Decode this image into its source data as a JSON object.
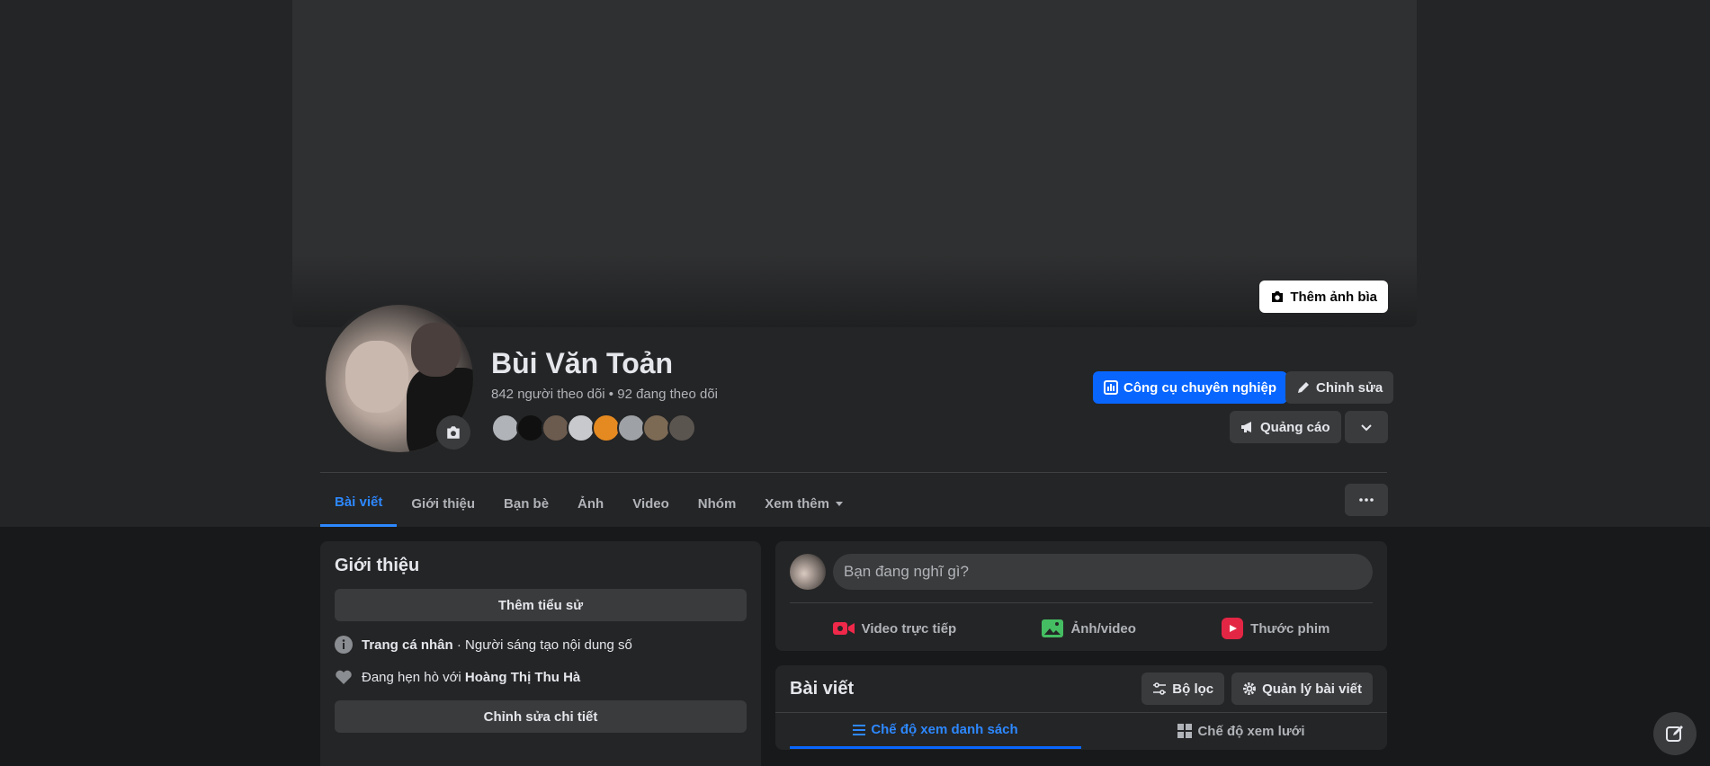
{
  "cover": {
    "add_cover_label": "Thêm ảnh bìa"
  },
  "profile": {
    "name": "Bùi Văn Toản",
    "stats": "842 người theo dõi • 92 đang theo dõi",
    "friend_avatar_colors": [
      "#b0b3b8",
      "#101010",
      "#6b5a4e",
      "#c7c9cc",
      "#e58a20",
      "#9ea1a5",
      "#7c6a55",
      "#5b5550"
    ]
  },
  "actions": {
    "pro_tools": "Công cụ chuyên nghiệp",
    "edit": "Chỉnh sửa",
    "ads": "Quảng cáo"
  },
  "tabs": [
    {
      "label": "Bài viết",
      "active": true
    },
    {
      "label": "Giới thiệu"
    },
    {
      "label": "Bạn bè"
    },
    {
      "label": "Ảnh"
    },
    {
      "label": "Video"
    },
    {
      "label": "Nhóm"
    },
    {
      "label": "Xem thêm"
    }
  ],
  "intro": {
    "title": "Giới thiệu",
    "add_bio": "Thêm tiểu sử",
    "page_label": "Trang cá nhân",
    "page_value": " · Người sáng tạo nội dung số",
    "dating_prefix": "Đang hẹn hò với ",
    "dating_name": "Hoàng Thị Thu Hà",
    "edit_details": "Chỉnh sửa chi tiết"
  },
  "composer": {
    "placeholder": "Bạn đang nghĩ gì?",
    "live_video": "Video trực tiếp",
    "photo_video": "Ảnh/video",
    "reel": "Thước phim"
  },
  "posts": {
    "title": "Bài viết",
    "filter": "Bộ lọc",
    "manage": "Quản lý bài viết",
    "list_view": "Chế độ xem danh sách",
    "grid_view": "Chế độ xem lưới"
  },
  "colors": {
    "accent": "#0866ff",
    "tab_active": "#2d88ff",
    "bg": "#18191a",
    "card": "#242526"
  }
}
